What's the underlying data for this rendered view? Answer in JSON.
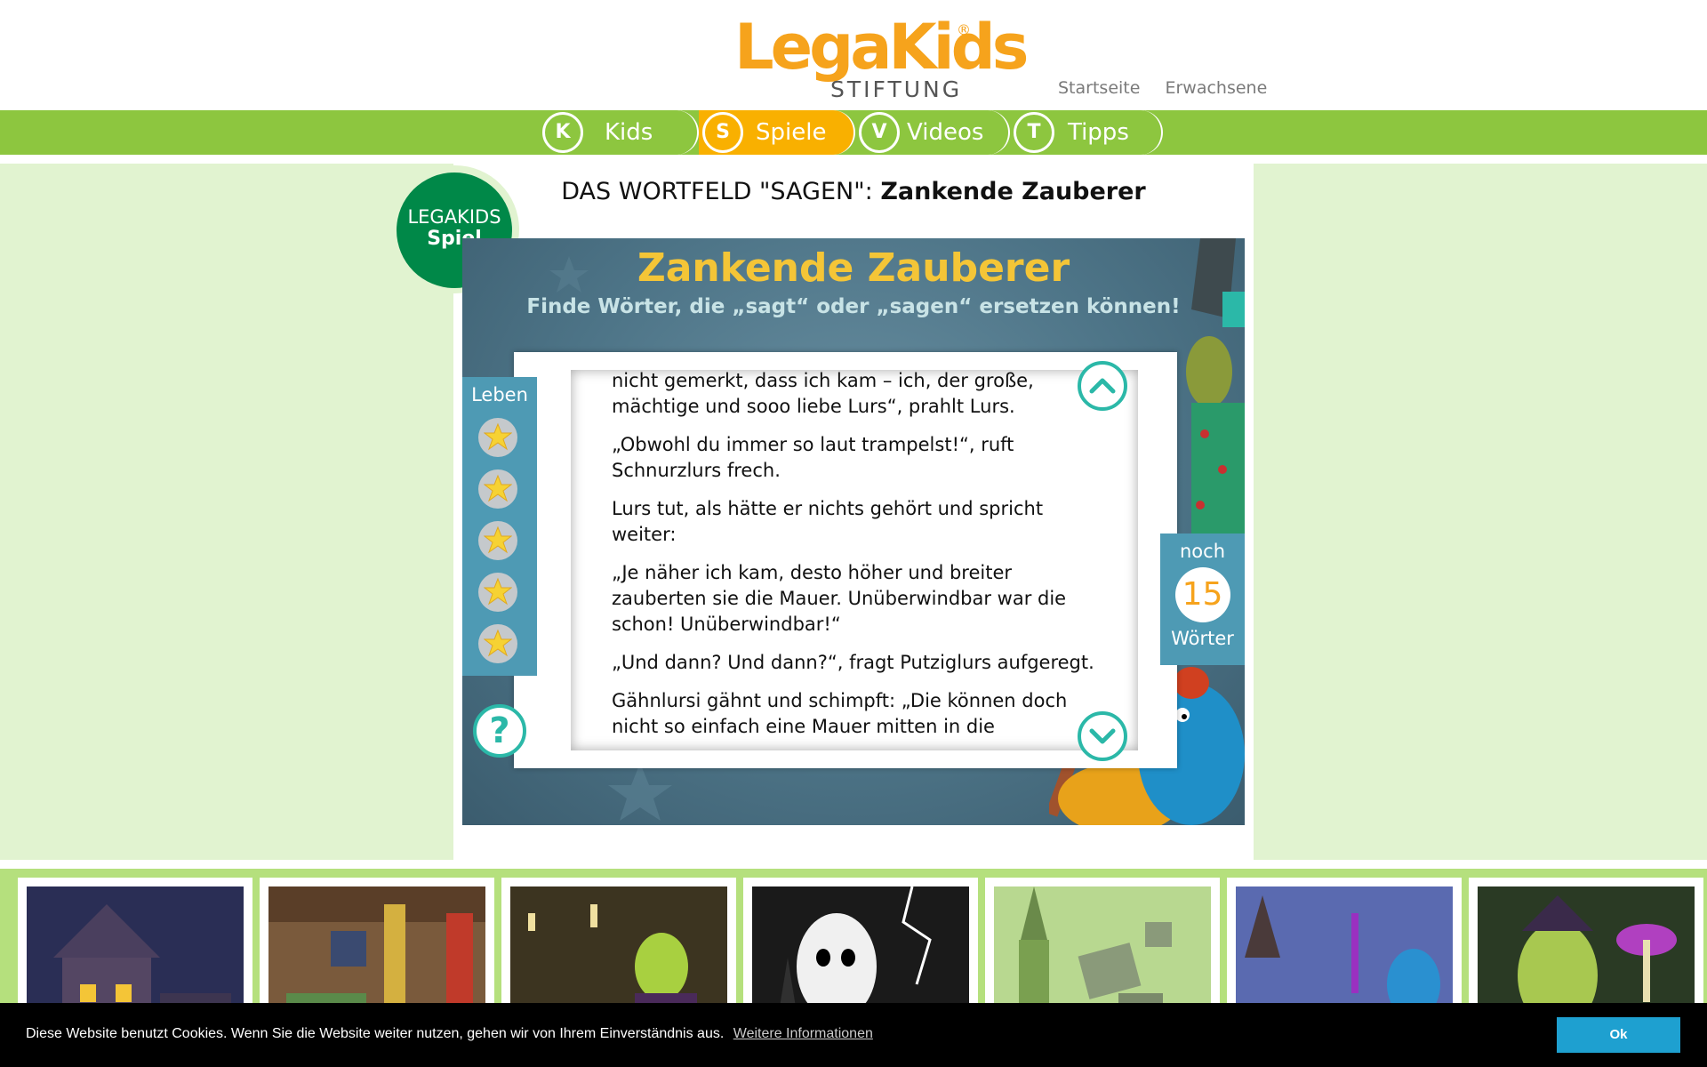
{
  "header": {
    "logo_main": "LegaKids",
    "logo_reg": "®",
    "logo_sub": "STIFTUNG",
    "links": [
      "Startseite",
      "Erwachsene"
    ]
  },
  "nav": [
    {
      "badge": "K",
      "label": "Kids",
      "active": false
    },
    {
      "badge": "S",
      "label": "Spiele",
      "active": true
    },
    {
      "badge": "V",
      "label": "Videos",
      "active": false
    },
    {
      "badge": "T",
      "label": "Tipps",
      "active": false
    }
  ],
  "colors": {
    "nav_green": "#8dc63f",
    "nav_active": "#f9b000",
    "side_green": "#e1f3d0",
    "badge_green": "#008848",
    "accent_teal": "#2bb8a8"
  },
  "badge": {
    "line1": "LEGAKIDS",
    "line2": "Spiel"
  },
  "title": {
    "prefix": "DAS WORTFELD \"SAGEN\":",
    "bold": "Zankende Zauberer"
  },
  "game": {
    "title": "Zankende Zauberer",
    "subtitle": "Finde Wörter, die „sagt“ oder „sagen“ ersetzen können!",
    "lives_label": "Leben",
    "lives_count": 5,
    "help_symbol": "?",
    "counter_top": "noch",
    "counter_value": "15",
    "counter_bottom": "Wörter",
    "paragraphs": [
      "nicht gemerkt, dass ich kam – ich, der große, mächtige und sooo liebe Lurs“, prahlt Lurs.",
      "„Obwohl du immer so laut trampelst!“, ruft Schnurzlurs frech.",
      "Lurs tut, als hätte er nichts gehört und spricht weiter:",
      "„Je näher ich kam, desto höher und breiter zauberten sie die Mauer. Unüberwindbar war die schon! Unüberwindbar!“",
      "„Und dann? Und dann?“, fragt Putziglurs aufgeregt.",
      "Gähnlursi gähnt und schimpft: „Die können doch nicht so einfach eine Mauer mitten in die"
    ]
  },
  "thumbnails": [
    "haunted-house",
    "attic-room",
    "witch-cellar",
    "ghost",
    "wizard-rubble",
    "wizard-feast",
    "witch-mushroom"
  ],
  "cookie": {
    "text": "Diese Website benutzt Cookies. Wenn Sie die Website weiter nutzen, gehen wir von Ihrem Einverständnis aus.",
    "link": "Weitere Informationen",
    "ok": "Ok"
  }
}
